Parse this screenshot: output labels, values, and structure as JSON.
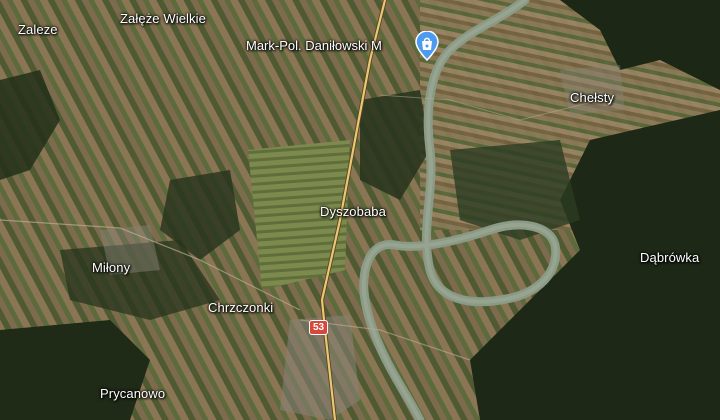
{
  "map": {
    "places": {
      "zaleze": "Zaleze",
      "zaleze_wielkie": "Załęże Wielkie",
      "chelsty": "Chełsty",
      "dyszobaba": "Dyszobaba",
      "dabrowka": "Dąbrówka",
      "milony": "Miłony",
      "chrzczonki": "Chrzczonki",
      "prycanowo": "Prycanowo"
    },
    "poi": {
      "label": "Mark-Pol. Daniłowski M",
      "icon": "shopping-bag-icon",
      "color": "#4c9bf0"
    },
    "road_shield": {
      "label": "53",
      "color": "#d9473a"
    },
    "colors": {
      "road": "#e8c777",
      "river": "#8a9a86",
      "forest": "#1f2a17",
      "fields": "#6b5a3f"
    }
  }
}
